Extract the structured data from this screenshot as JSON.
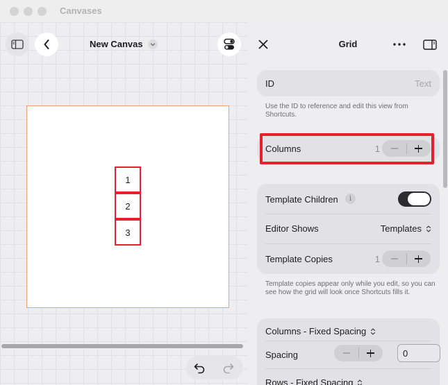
{
  "window": {
    "title": "Canvases"
  },
  "canvas": {
    "title": "New Canvas",
    "items": [
      "1",
      "2",
      "3"
    ]
  },
  "inspector": {
    "title": "Grid",
    "id_field": {
      "label": "ID",
      "placeholder": "Text"
    },
    "id_help": "Use the ID to reference and edit this view from Shortcuts.",
    "columns": {
      "label": "Columns",
      "value": "1"
    },
    "template_children": {
      "label": "Template Children",
      "enabled": true
    },
    "editor_shows": {
      "label": "Editor Shows",
      "value": "Templates"
    },
    "template_copies": {
      "label": "Template Copies",
      "value": "1"
    },
    "copies_help": "Template copies appear only while you edit, so you can see how the grid will look once Shortcuts fills it.",
    "columns_mode": {
      "label": "Columns - Fixed Spacing"
    },
    "spacing": {
      "label": "Spacing",
      "value": "0"
    },
    "rows_mode": {
      "label": "Rows - Fixed Spacing"
    }
  },
  "colors": {
    "accent_highlight": "#e8202e",
    "canvas_border": "#f5a36a"
  }
}
